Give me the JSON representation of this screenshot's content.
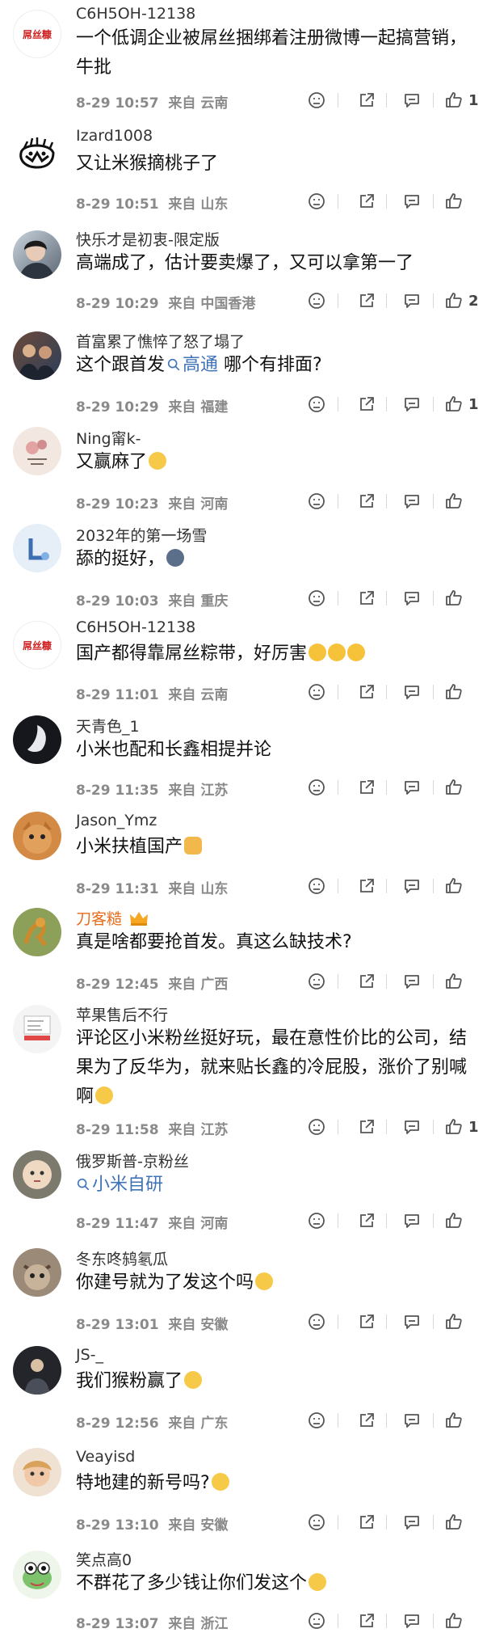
{
  "comments": [
    {
      "user": "C6H5OH-12138",
      "text": "一个低调企业被屌丝捆绑着注册微博一起搞营销，牛批",
      "time": "8-29 10:57",
      "from": "来自 云南",
      "likes": "1",
      "avatar_text": "屌丝糠"
    },
    {
      "user": "Izard1008",
      "text": "又让米猴摘桃子了",
      "time": "8-29 10:51",
      "from": "来自 山东",
      "likes": ""
    },
    {
      "user": "快乐才是初衷-限定版",
      "text": "高端成了，估计要卖爆了，又可以拿第一了",
      "time": "8-29 10:29",
      "from": "来自 中国香港",
      "likes": "2"
    },
    {
      "user": "首富累了憔悴了怒了塌了",
      "text_before": "这个跟首发",
      "link": "高通",
      "text_after": " 哪个有排面?",
      "time": "8-29 10:29",
      "from": "来自 福建",
      "likes": "1"
    },
    {
      "user": "Ning甯k-",
      "text": "又赢麻了",
      "time": "8-29 10:23",
      "from": "来自 河南",
      "likes": ""
    },
    {
      "user": "2032年的第一场雪",
      "text": "舔的挺好，",
      "time": "8-29 10:03",
      "from": "来自 重庆",
      "likes": ""
    },
    {
      "user": "C6H5OH-12138",
      "text": "国产都得靠屌丝粽带，好厉害",
      "time": "8-29 11:01",
      "from": "来自 云南",
      "likes": "",
      "avatar_text": "屌丝糠"
    },
    {
      "user": "天青色_1",
      "text": "小米也配和长鑫相提并论",
      "time": "8-29 11:35",
      "from": "来自 江苏",
      "likes": ""
    },
    {
      "user": "Jason_Ymz",
      "text": "小米扶植国产",
      "time": "8-29 11:31",
      "from": "来自 山东",
      "likes": ""
    },
    {
      "user": "刀客糙",
      "text": "真是啥都要抢首发。真这么缺技术?",
      "time": "8-29 12:45",
      "from": "来自 广西",
      "likes": ""
    },
    {
      "user": "苹果售后不行",
      "text": "评论区小米粉丝挺好玩，最在意性价比的公司，结果为了反华为，就来贴长鑫的冷屁股，涨价了别喊啊",
      "time": "8-29 11:58",
      "from": "来自 江苏",
      "likes": "1"
    },
    {
      "user": "俄罗斯普-京粉丝",
      "link": "小米自研",
      "time": "8-29 11:47",
      "from": "来自 河南",
      "likes": ""
    },
    {
      "user": "冬东咚鸫氡瓜",
      "text": "你建号就为了发这个吗",
      "time": "8-29 13:01",
      "from": "来自 安徽",
      "likes": ""
    },
    {
      "user": "JS-_",
      "text": "我们猴粉赢了",
      "time": "8-29 12:56",
      "from": "来自 广东",
      "likes": ""
    },
    {
      "user": "Veayisd",
      "text": "特地建的新号吗?",
      "time": "8-29 13:10",
      "from": "来自 安徽",
      "likes": ""
    },
    {
      "user": "笑点高0",
      "text": "不群花了多少钱让你们发这个",
      "time": "8-29 13:07",
      "from": "来自 浙江",
      "likes": ""
    }
  ],
  "colors": {
    "link": "#3f73b8",
    "username_vip": "#e86b1a",
    "meta": "#8a8a8a"
  }
}
